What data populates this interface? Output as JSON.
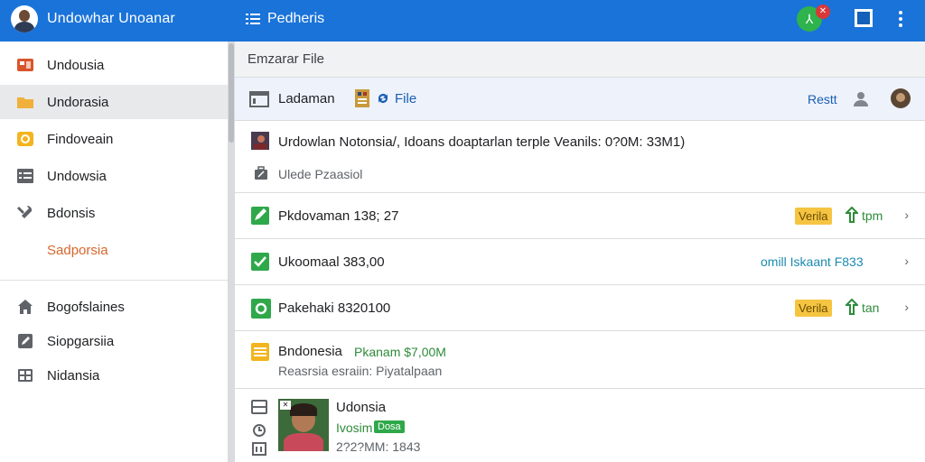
{
  "topbar": {
    "app_title": "Undowhar Unoanar",
    "menu_title": "Pedheris",
    "status_icon_glyph": "⅄",
    "badge_glyph": "✕",
    "accent_color": "#1a73d9"
  },
  "sidebar": {
    "items": [
      {
        "label": "Undousia",
        "icon": "image-icon",
        "color": "#d8552b"
      },
      {
        "label": "Undorasia",
        "icon": "folder-icon",
        "color": "#f0b03a"
      },
      {
        "label": "Findoveain",
        "icon": "coin-icon",
        "color": "#f2b51f"
      },
      {
        "label": "Undowsia",
        "icon": "list-icon",
        "color": "#5f6368"
      },
      {
        "label": "Bdonsis",
        "icon": "tools-icon",
        "color": "#5f6368"
      },
      {
        "label": "Sadporsia"
      },
      {
        "label": "Bogofslaines",
        "icon": "home-icon",
        "color": "#5f6368"
      },
      {
        "label": "Siopgarsiia",
        "icon": "edit-icon",
        "color": "#5f6368"
      },
      {
        "label": "Nidansia",
        "icon": "grid-icon",
        "color": "#5f6368"
      }
    ]
  },
  "main": {
    "section_title": "Emzarar File",
    "toolbar": {
      "label": "Ladaman",
      "file_label": "File",
      "reset_label": "Restt"
    },
    "row1": {
      "title": "Urdowlan Notonsia/, Idoans doaptarlan terple Veanils: 0?0M: 33M1)",
      "subtitle": "Ulede Pzaasiol"
    },
    "row2": {
      "title": "Pkdovaman 138; 27",
      "tag": "Verila",
      "action": "tpm"
    },
    "row3": {
      "title": "Ukoomaal 383,00",
      "status": "omill Iskaant F833"
    },
    "row4": {
      "title": "Pakehaki 8320100",
      "tag": "Verila",
      "action": "tan"
    },
    "row5": {
      "title": "Bndonesia",
      "amount": "Pkanam $7,00M",
      "subtitle": "Reasrsia esraiin: Piyatalpaan"
    },
    "row6": {
      "name": "Udonsia",
      "line2": "Ivosim",
      "badge": "Dosa",
      "line3": "2?2?MM: 1843"
    }
  }
}
